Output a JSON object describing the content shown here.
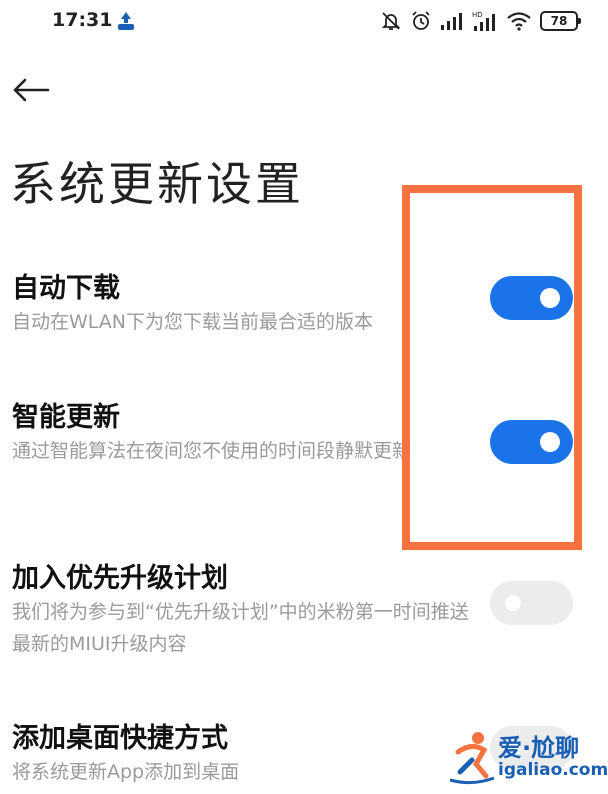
{
  "status_bar": {
    "time": "17:31",
    "battery_level": "78",
    "icons": [
      "app-notification-icon",
      "mute-icon",
      "alarm-icon",
      "signal-icon",
      "hd-signal-icon",
      "wifi-icon",
      "battery-icon"
    ]
  },
  "header": {
    "back_icon": "arrow-left-icon",
    "title": "系统更新设置"
  },
  "settings": [
    {
      "title": "自动下载",
      "description": "自动在WLAN下为您下载当前最合适的版本",
      "enabled": true
    },
    {
      "title": "智能更新",
      "description": "通过智能算法在夜间您不使用的时间段静默更新",
      "enabled": true
    },
    {
      "title": "加入优先升级计划",
      "description": "我们将为参与到“优先升级计划”中的米粉第一时间推送最新的MIUI升级内容",
      "enabled": false
    },
    {
      "title": "添加桌面快捷方式",
      "description": "将系统更新App添加到桌面",
      "enabled": false
    }
  ],
  "colors": {
    "toggle_on": "#1a73e8",
    "toggle_off": "#ececec",
    "highlight": "#f47341",
    "description_text": "#9a9a9a"
  },
  "watermark": {
    "line1": "爱·尬聊",
    "line2": "igaliao.com"
  }
}
